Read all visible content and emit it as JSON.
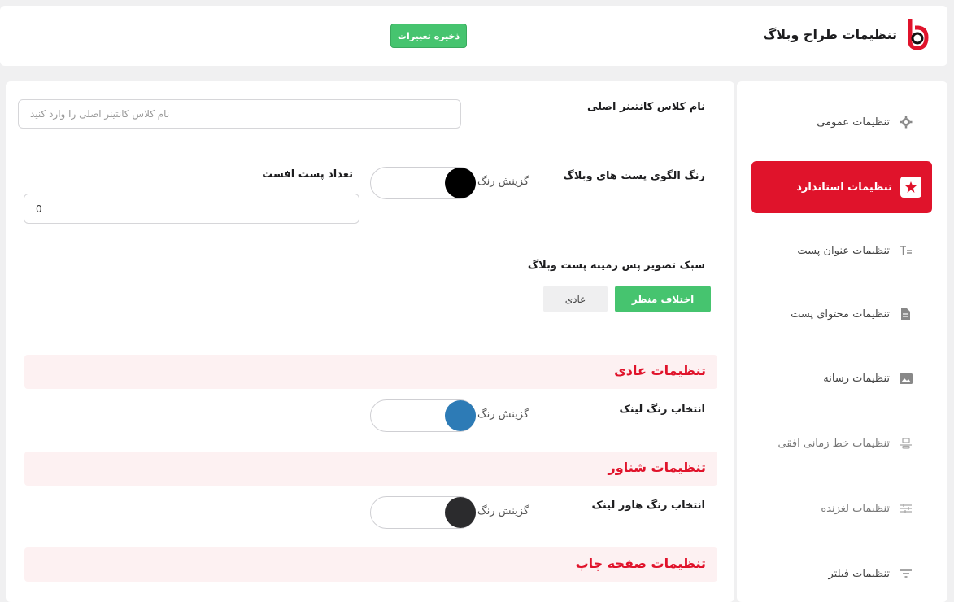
{
  "header": {
    "title": "تنظیمات طراح وبلاگ",
    "save_label": "ذخیره تغییرات",
    "brand_icon": "brand-logo-icon"
  },
  "sidebar": {
    "items": [
      {
        "label": "تنظیمات عمومی",
        "icon": "gear-icon",
        "state": "normal"
      },
      {
        "label": "تنظیمات استاندارد",
        "icon": "star-badge-icon",
        "state": "active"
      },
      {
        "label": "تنظیمات عنوان پست",
        "icon": "text-title-icon",
        "state": "normal"
      },
      {
        "label": "تنظیمات محتوای پست",
        "icon": "document-add-icon",
        "state": "normal"
      },
      {
        "label": "تنظیمات رسانه",
        "icon": "image-gallery-icon",
        "state": "normal"
      },
      {
        "label": "تنظیمات خط زمانی افقی",
        "icon": "timeline-icon",
        "state": "dim"
      },
      {
        "label": "تنظیمات لغزنده",
        "icon": "sliders-icon",
        "state": "dim"
      },
      {
        "label": "تنظیمات فیلتر",
        "icon": "filter-icon",
        "state": "normal"
      }
    ]
  },
  "main": {
    "container_class": {
      "label": "نام کلاس کانتینر اصلی",
      "placeholder": "نام کلاس کانتینر اصلی را وارد کنید"
    },
    "post_color": {
      "label": "رنگ الگوی پست های وبلاگ",
      "picker_label": "گزینش رنگ",
      "color": "#000000"
    },
    "offset": {
      "label": "تعداد پست افست",
      "value": "0"
    },
    "bg_style": {
      "label": "سبک تصویر پس زمینه پست وبلاگ",
      "options": [
        "اختلاف منظر",
        "عادی"
      ],
      "selected": "اختلاف منظر"
    },
    "sections": [
      {
        "title": "تنظیمات عادی",
        "field_label": "انتخاب رنگ لینک",
        "picker_label": "گزینش رنگ",
        "color": "#2d7bb6"
      },
      {
        "title": "تنظیمات شناور",
        "field_label": "انتخاب رنگ هاور لینک",
        "picker_label": "گزینش رنگ",
        "color": "#2b2b2d"
      },
      {
        "title": "تنظیمات صفحه چاپ"
      }
    ]
  },
  "colors": {
    "accent": "#e0132b",
    "success": "#46c46f",
    "section_bg": "#fdf1f2"
  }
}
